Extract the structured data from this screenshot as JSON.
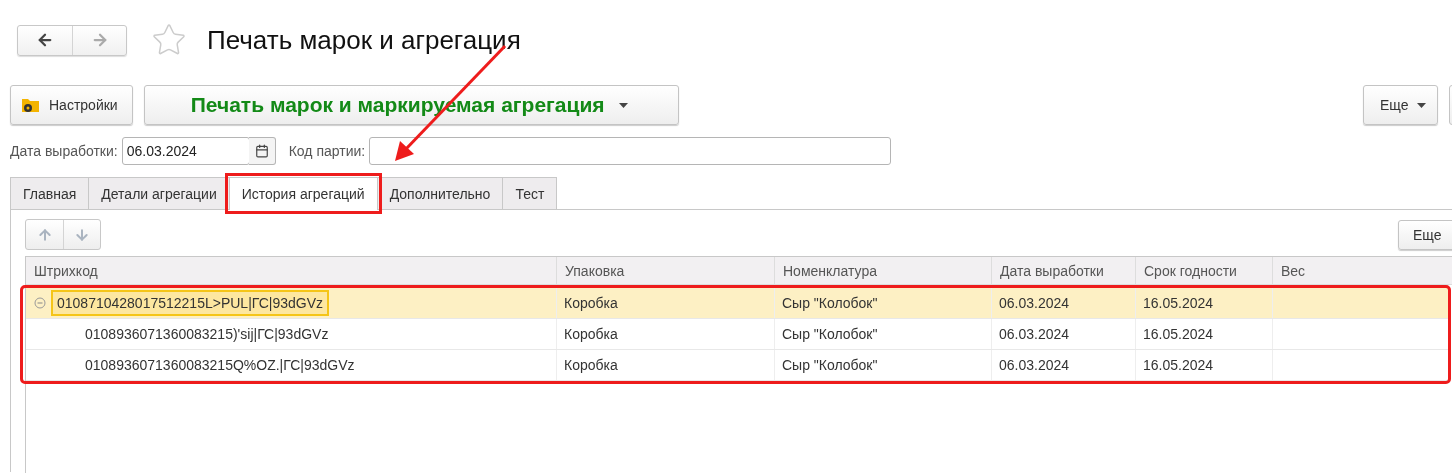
{
  "nav": {
    "back_enabled": true,
    "forward_enabled": false
  },
  "favorite": false,
  "title": "Печать марок и агрегация",
  "toolbar": {
    "settings": "Настройки",
    "print_menu": "Печать марок и маркируемая агрегация",
    "more": "Еще"
  },
  "filters": [
    {
      "kind": "date",
      "label": "Дата выработки:",
      "value": "06.03.2024"
    },
    {
      "kind": "text",
      "label": "Код партии:"
    }
  ],
  "tabs": [
    {
      "label": "Главная",
      "selected": false,
      "outlined": false
    },
    {
      "label": "Детали агрегации",
      "selected": false,
      "outlined": false
    },
    {
      "label": "История агрегаций",
      "selected": true,
      "outlined": true
    },
    {
      "label": "Дополнительно",
      "selected": false,
      "outlined": false
    },
    {
      "label": "Тест",
      "selected": false,
      "outlined": false
    }
  ],
  "panel": {
    "more": "Еще"
  },
  "table": {
    "columns": [
      "Штрихкод",
      "Упаковка",
      "Номенклатура",
      "Дата выработки",
      "Срок годности",
      "Вес"
    ],
    "outlined": true,
    "rows": [
      {
        "barcode": "0108710428017512215L>PUL|ГС|93dGVz",
        "package": "Коробка",
        "product": "Сыр \"Колобок\"",
        "date": "06.03.2024",
        "expiry": "16.05.2024",
        "selected": true,
        "expanded": true,
        "children": [
          {
            "barcode": "0108936071360083215)'sij|ГС|93dGVz",
            "package": "Коробка",
            "product": "Сыр \"Колобок\"",
            "date": "06.03.2024",
            "expiry": "16.05.2024",
            "selected": false
          },
          {
            "barcode": "0108936071360083215Q%OZ.|ГС|93dGVz",
            "package": "Коробка",
            "product": "Сыр \"Колобок\"",
            "date": "06.03.2024",
            "expiry": "16.05.2024",
            "selected": false
          }
        ]
      }
    ]
  },
  "annotation_arrow": true
}
